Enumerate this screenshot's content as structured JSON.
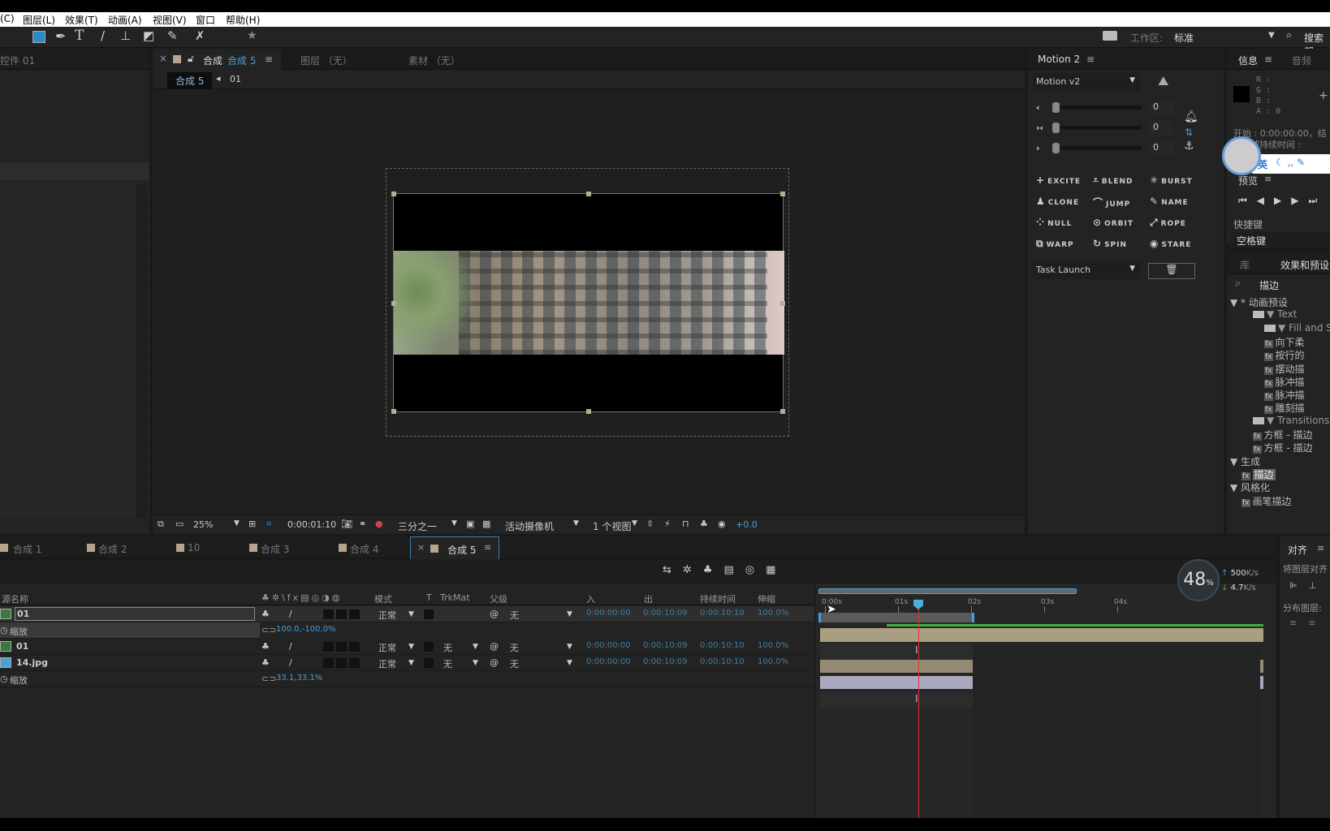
{
  "menu": [
    "(C)",
    "图层(L)",
    "效果(T)",
    "动画(A)",
    "视图(V)",
    "窗口",
    "帮助(H)"
  ],
  "toolbar": {
    "workspace_label": "工作区:",
    "workspace_value": "标准",
    "search": "搜索帮"
  },
  "left_panel": {
    "tab": "控件 01"
  },
  "viewer": {
    "tabs": [
      {
        "label": "合成",
        "comp": "合成 5"
      },
      {
        "label": "图层 （无）"
      },
      {
        "label": "素材 （无）"
      }
    ],
    "breadcrumb": [
      "合成 5",
      "01"
    ],
    "bottom": {
      "zoom": "25%",
      "timecode": "0:00:01:10",
      "resolution": "三分之一",
      "camera": "活动摄像机",
      "views": "1 个视图",
      "exposure": "+0.0"
    }
  },
  "motion": {
    "title": "Motion 2",
    "preset": "Motion v2",
    "sliders": [
      {
        "icon": "‹",
        "value": "0"
      },
      {
        "icon": "›‹",
        "value": "0"
      },
      {
        "icon": "›",
        "value": "0"
      }
    ],
    "tools": [
      [
        "EXCITE",
        "BLEND",
        "BURST"
      ],
      [
        "CLONE",
        "JUMP",
        "NAME"
      ],
      [
        "NULL",
        "ORBIT",
        "ROPE"
      ],
      [
        "WARP",
        "SPIN",
        "STARE"
      ]
    ],
    "task": "Task Launch"
  },
  "info": {
    "tab1": "信息",
    "tab2": "音频",
    "r": "R :",
    "g": "G :",
    "b": "B :",
    "a": "A : 0",
    "start": "开始 : 0:00:00:00，结",
    "duration": "区域持续时间 :",
    "ime": "英",
    "preview_title": "预览",
    "shortcut_label": "快捷键",
    "shortcut_value": "空格键"
  },
  "effects": {
    "tab1": "库",
    "tab2": "效果和预设",
    "search": "描边",
    "tree": [
      {
        "t": "▼ * 动画预设",
        "i": 0
      },
      {
        "t": "▼ Text",
        "i": 1,
        "folder": true
      },
      {
        "t": "▼ Fill and Stro",
        "i": 2,
        "folder": true
      },
      {
        "t": "向下柔",
        "i": 3,
        "fx": true
      },
      {
        "t": "按行的",
        "i": 3,
        "fx": true
      },
      {
        "t": "摆动描",
        "i": 3,
        "fx": true
      },
      {
        "t": "脉冲描",
        "i": 3,
        "fx": true
      },
      {
        "t": "脉冲描",
        "i": 3,
        "fx": true
      },
      {
        "t": "雕刻描",
        "i": 3,
        "fx": true
      },
      {
        "t": "▼ Transitions - D",
        "i": 1,
        "folder": true
      },
      {
        "t": "方框 - 描边",
        "i": 2,
        "fx": true
      },
      {
        "t": "方框 - 描边",
        "i": 2,
        "fx": true
      },
      {
        "t": "▼ 生成",
        "i": 0
      },
      {
        "t": "描边",
        "i": 1,
        "fx": true,
        "sel": true
      },
      {
        "t": "▼ 风格化",
        "i": 0
      },
      {
        "t": "画笔描边",
        "i": 1,
        "fx": true
      }
    ]
  },
  "timeline": {
    "tabs": [
      "合成 1",
      "合成 2",
      "10",
      "合成 3",
      "合成 4",
      "合成 5"
    ],
    "headers": {
      "name": "源名称",
      "mode": "模式",
      "t": "T",
      "trkmat": "TrkMat",
      "parent": "父级",
      "in": "入",
      "out": "出",
      "dur": "持续时间",
      "stretch": "伸缩"
    },
    "layers": [
      {
        "type": "layer",
        "name": "01",
        "mode": "正常",
        "trkmat": "",
        "parent": "无",
        "in": "0:00:00:00",
        "out": "0:00:10:09",
        "dur": "0:00:10:10",
        "stretch": "100.0%",
        "selected": true
      },
      {
        "type": "prop",
        "name": "缩放",
        "value": "100.0,-100.0%"
      },
      {
        "type": "layer",
        "name": "01",
        "mode": "正常",
        "trkmat": "无",
        "parent": "无",
        "in": "0:00:00:00",
        "out": "0:00:10:09",
        "dur": "0:00:10:10",
        "stretch": "100.0%"
      },
      {
        "type": "layer",
        "name": "14.jpg",
        "mode": "正常",
        "trkmat": "无",
        "parent": "无",
        "in": "0:00:00:00",
        "out": "0:00:10:09",
        "dur": "0:00:10:10",
        "stretch": "100.0%"
      },
      {
        "type": "prop",
        "name": "缩放",
        "value": "33.1,33.1%"
      }
    ],
    "ruler": [
      "0:00s",
      "01s",
      "02s",
      "03s",
      "04s"
    ],
    "net": {
      "percent": "48",
      "unit": "%",
      "up": "500",
      "down": "4.7",
      "rate_unit": "K/s"
    }
  },
  "align": {
    "title": "对齐",
    "label1": "将图层对齐",
    "label2": "分布图层:"
  }
}
